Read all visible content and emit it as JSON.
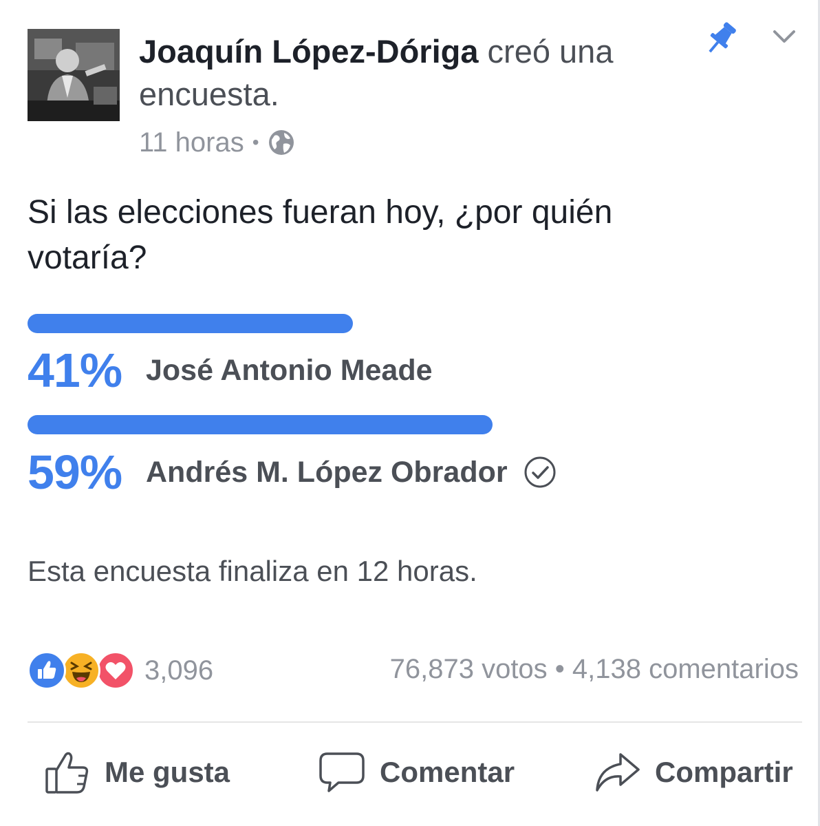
{
  "post": {
    "author": "Joaquín López-Dóriga",
    "action_text": " creó una encuesta.",
    "time": "11 horas",
    "separator": "•",
    "privacy_icon": "globe-icon"
  },
  "poll": {
    "question": "Si las elecciones fueran hoy, ¿por quién votaría?",
    "options": [
      {
        "percent": 41,
        "percent_label": "41%",
        "name": "José Antonio Meade",
        "selected": false
      },
      {
        "percent": 59,
        "percent_label": "59%",
        "name": "Andrés M. López Obrador",
        "selected": true
      }
    ],
    "ends_text": "Esta encuesta finaliza en 12 horas."
  },
  "footer": {
    "reactions": [
      "like-icon",
      "haha-icon",
      "love-icon"
    ],
    "reaction_count": "3,096",
    "votes": "76,873 votos",
    "stats_separator": " • ",
    "comments": "4,138 comentarios"
  },
  "actions": {
    "like": "Me gusta",
    "comment": "Comentar",
    "share": "Compartir"
  },
  "colors": {
    "accent": "#4080ec",
    "text": "#1d2129",
    "secondary": "#4b4f56",
    "muted": "#90949c",
    "haha": "#f7b125",
    "love": "#f25268"
  }
}
